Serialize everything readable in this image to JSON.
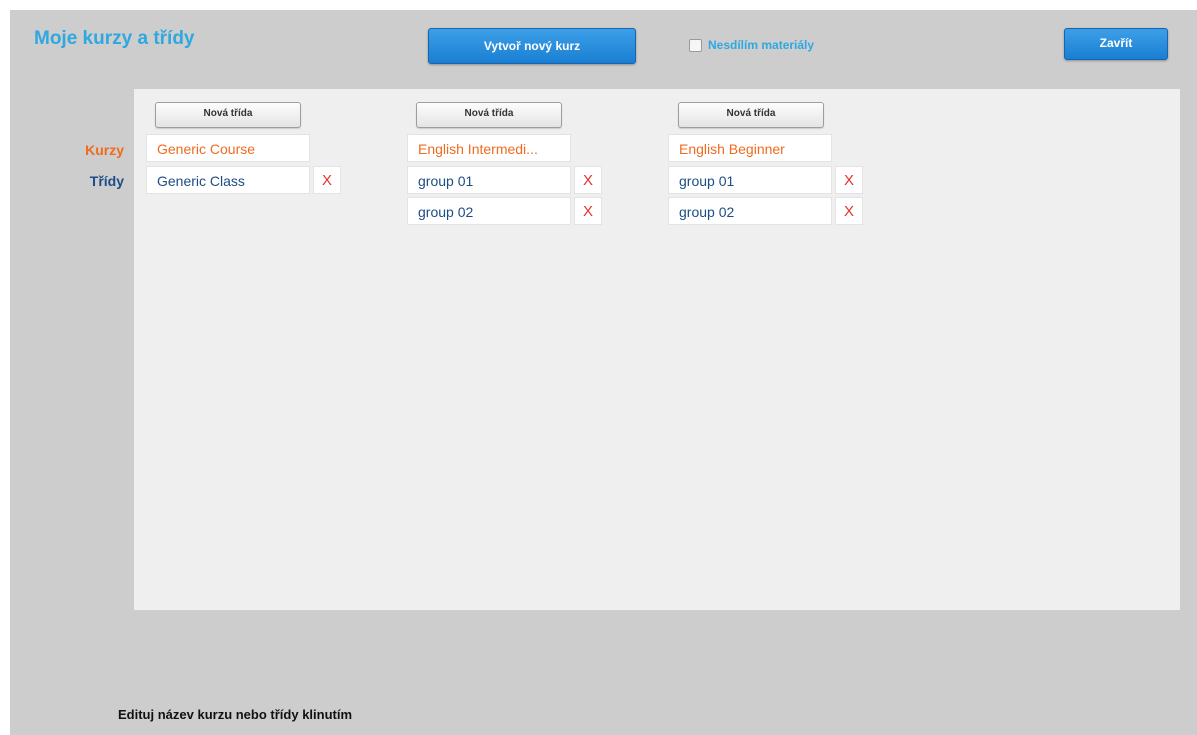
{
  "header": {
    "title": "Moje kurzy a třídy",
    "create_course_label": "Vytvoř nový kurz",
    "no_share_label": "Nesdílím materiály",
    "close_label": "Zavřít"
  },
  "row_labels": {
    "courses": "Kurzy",
    "classes": "Třídy"
  },
  "columns": [
    {
      "new_class_label": "Nová třída",
      "course": "Generic Course",
      "classes": [
        {
          "name": "Generic Class",
          "delete": "X"
        }
      ]
    },
    {
      "new_class_label": "Nová třída",
      "course": "English Intermedi...",
      "classes": [
        {
          "name": "group 01",
          "delete": "X"
        },
        {
          "name": "group 02",
          "delete": "X"
        }
      ]
    },
    {
      "new_class_label": "Nová třída",
      "course": "English Beginner",
      "classes": [
        {
          "name": "group 01",
          "delete": "X"
        },
        {
          "name": "group 02",
          "delete": "X"
        }
      ]
    }
  ],
  "footer": {
    "hint": "Edituj název kurzu nebo třídy klinutím"
  },
  "colors": {
    "title": "#2fa8e0",
    "course_text": "#ef6b1f",
    "class_text": "#1d4d85",
    "delete": "#e8322c",
    "button_blue": "#1a7fd3"
  },
  "icons": {
    "delete": "x-icon",
    "checkbox": "checkbox-unchecked-icon"
  }
}
